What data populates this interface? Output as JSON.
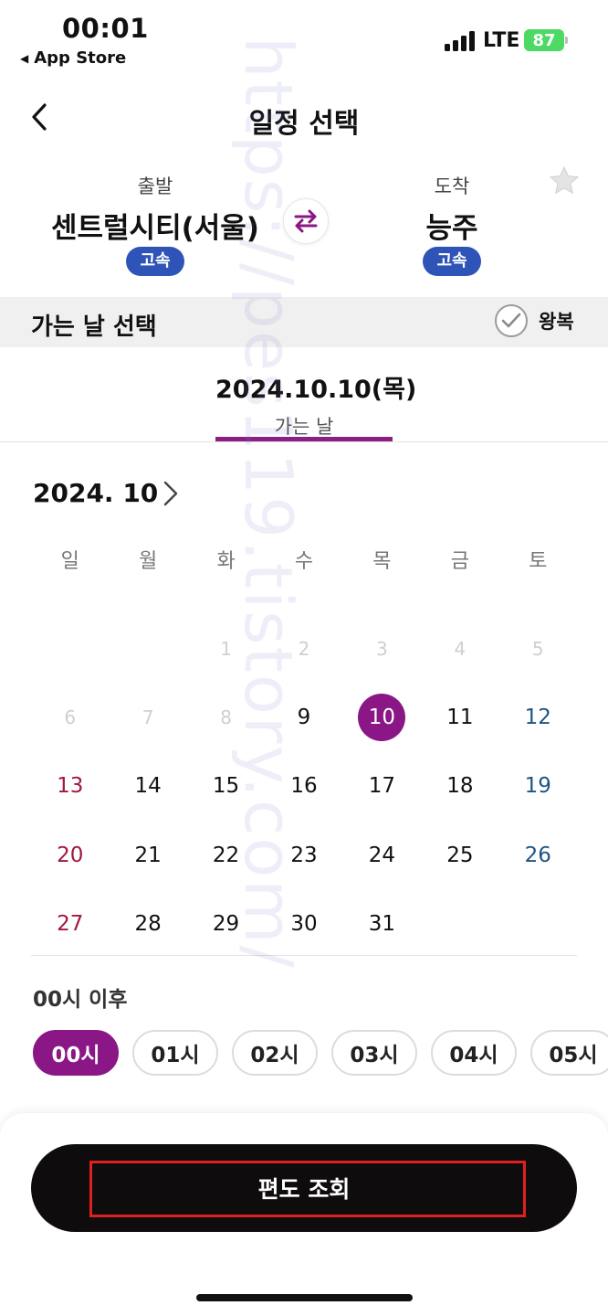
{
  "status_bar": {
    "time": "00:01",
    "back_app": "App Store",
    "network": "LTE",
    "battery": "87"
  },
  "header": {
    "title": "일정 선택"
  },
  "route": {
    "departure": {
      "label": "출발",
      "station": "센트럴시티(서울)",
      "type": "고속"
    },
    "arrival": {
      "label": "도착",
      "station": "능주",
      "type": "고속"
    }
  },
  "select_bar": {
    "title": "가는 날 선택",
    "roundtrip_label": "왕복"
  },
  "date_tab": {
    "date": "2024.10.10(목)",
    "label": "가는 날"
  },
  "calendar": {
    "month": "2024. 10",
    "weekdays": [
      "일",
      "월",
      "화",
      "수",
      "목",
      "금",
      "토"
    ],
    "leading_blanks": 2,
    "selected_day": 10,
    "first_available_day": 9,
    "days_in_month": 31
  },
  "time_filter": {
    "label": "00시 이후",
    "chips": [
      "00시",
      "01시",
      "02시",
      "03시",
      "04시",
      "05시"
    ],
    "active_index": 0
  },
  "actions": {
    "search_label": "편도 조회"
  },
  "watermark": "https://pes119.tistory.com/",
  "colors": {
    "accent": "#8a1785",
    "badge": "#2f54b8",
    "sunday": "#a0183d",
    "saturday": "#1d5586",
    "button": "#0e0c0c"
  }
}
